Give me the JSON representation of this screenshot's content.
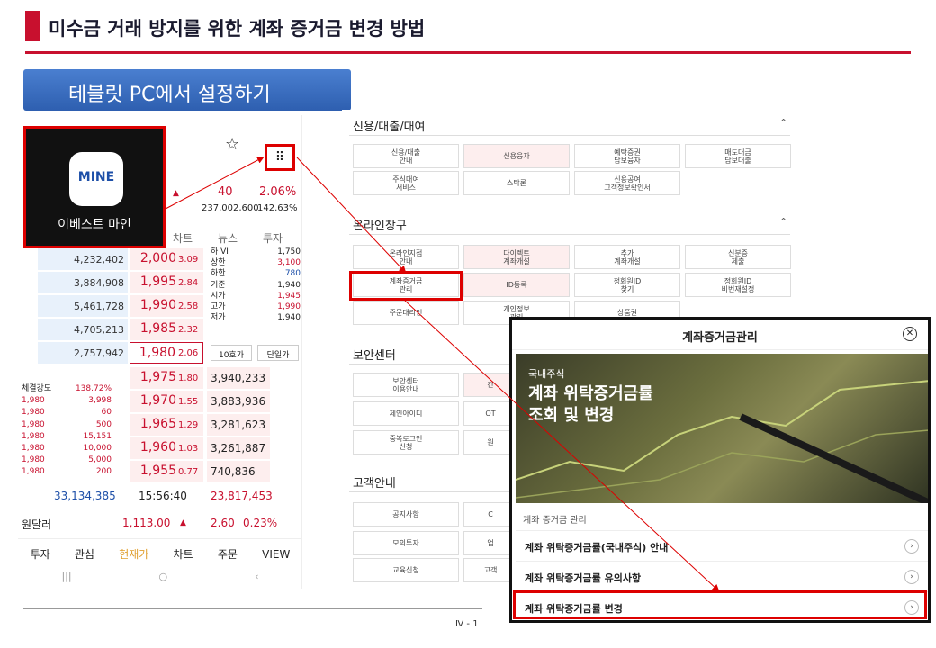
{
  "title": "미수금 거래 방지를 위한 계좌 증거금 변경 방법",
  "subtitle": "테블릿 PC에서 설정하기",
  "mine": {
    "logo_text": "MINE",
    "label": "이베스트 마인"
  },
  "phone": {
    "header_values": {
      "change": "40",
      "pct": "2.06%",
      "volume": "237,002,600",
      "vol_pct": "142.63%"
    },
    "tabs": [
      "차트",
      "뉴스",
      "투자"
    ],
    "rows": [
      {
        "bid": "4,232,402",
        "price": "2,000",
        "pct": "3.09"
      },
      {
        "bid": "3,884,908",
        "price": "1,995",
        "pct": "2.84"
      },
      {
        "bid": "5,461,728",
        "price": "1,990",
        "pct": "2.58"
      },
      {
        "bid": "4,705,213",
        "price": "1,985",
        "pct": "2.32"
      },
      {
        "bid": "2,757,942",
        "price": "1,980",
        "pct": "2.06"
      }
    ],
    "side_info": [
      {
        "k": "하 VI",
        "v": "1,750"
      },
      {
        "k": "상한",
        "v": "3,100"
      },
      {
        "k": "하한",
        "v": "780"
      },
      {
        "k": "기준",
        "v": "1,940"
      },
      {
        "k": "시가",
        "v": "1,945"
      },
      {
        "k": "고가",
        "v": "1,990"
      },
      {
        "k": "저가",
        "v": "1,940"
      }
    ],
    "btn_10": "10호가",
    "btn_single": "단일가",
    "ask_rows": [
      {
        "price": "1,975",
        "pct": "1.80",
        "ask": "3,940,233"
      },
      {
        "price": "1,970",
        "pct": "1.55",
        "ask": "3,883,936"
      },
      {
        "price": "1,965",
        "pct": "1.29",
        "ask": "3,281,623"
      },
      {
        "price": "1,960",
        "pct": "1.03",
        "ask": "3,261,887"
      },
      {
        "price": "1,955",
        "pct": "0.77",
        "ask": "740,836"
      }
    ],
    "strength_label": "체결강도",
    "strength_value": "138.72%",
    "trades": [
      {
        "p": "1,980",
        "q": "3,998"
      },
      {
        "p": "1,980",
        "q": "60"
      },
      {
        "p": "1,980",
        "q": "500"
      },
      {
        "p": "1,980",
        "q": "15,151"
      },
      {
        "p": "1,980",
        "q": "10,000"
      },
      {
        "p": "1,980",
        "q": "5,000"
      },
      {
        "p": "1,980",
        "q": "200"
      }
    ],
    "total_bid": "33,134,385",
    "time": "15:56:40",
    "total_ask": "23,817,453",
    "fx_label": "원달러",
    "fx_value": "1,113.00",
    "fx_change": "2.60",
    "fx_pct": "0.23%",
    "bottom_tabs": [
      "투자",
      "관심",
      "현재가",
      "차트",
      "주문",
      "VIEW"
    ]
  },
  "menu": {
    "sections": [
      {
        "title": "신용/대출/대여",
        "items": [
          "신용/대출\n안내",
          "신용융자",
          "예탁증권\n담보융자",
          "매도대금\n담보대출",
          "주식대여\n서비스",
          "스탁론",
          "신용공여\n고객정보확인서"
        ]
      },
      {
        "title": "온라인창구",
        "items": [
          "온라인지점\n안내",
          "다이렉트\n계좌개설",
          "추가\n계좌개설",
          "신분증\n제출",
          "계좌증거금\n관리",
          "ID등록",
          "정회원ID\n찾기",
          "정회원ID\n비번재설정",
          "주문대리인",
          "개인정보\n관리",
          "상품권"
        ]
      },
      {
        "title": "보안센터",
        "items": [
          "보안센터\n이용안내",
          "간",
          "",
          "체인아이디",
          "OT",
          "",
          "중복로그인\n신청",
          "원"
        ]
      },
      {
        "title": "고객안내",
        "items": [
          "공지사항",
          "C",
          "모의투자",
          "업",
          "교육신청",
          "고객"
        ]
      }
    ]
  },
  "popup": {
    "title": "계좌증거금관리",
    "banner_sub": "국내주식",
    "banner_line1": "계좌 위탁증거금률",
    "banner_line2": "조회 및 변경",
    "section_label": "계좌 증거금 관리",
    "items": [
      "계좌 위탁증거금률(국내주식) 안내",
      "계좌 위탁증거금률 유의사항",
      "계좌 위탁증거금률 변경"
    ]
  },
  "page_number": "Ⅳ - 1"
}
